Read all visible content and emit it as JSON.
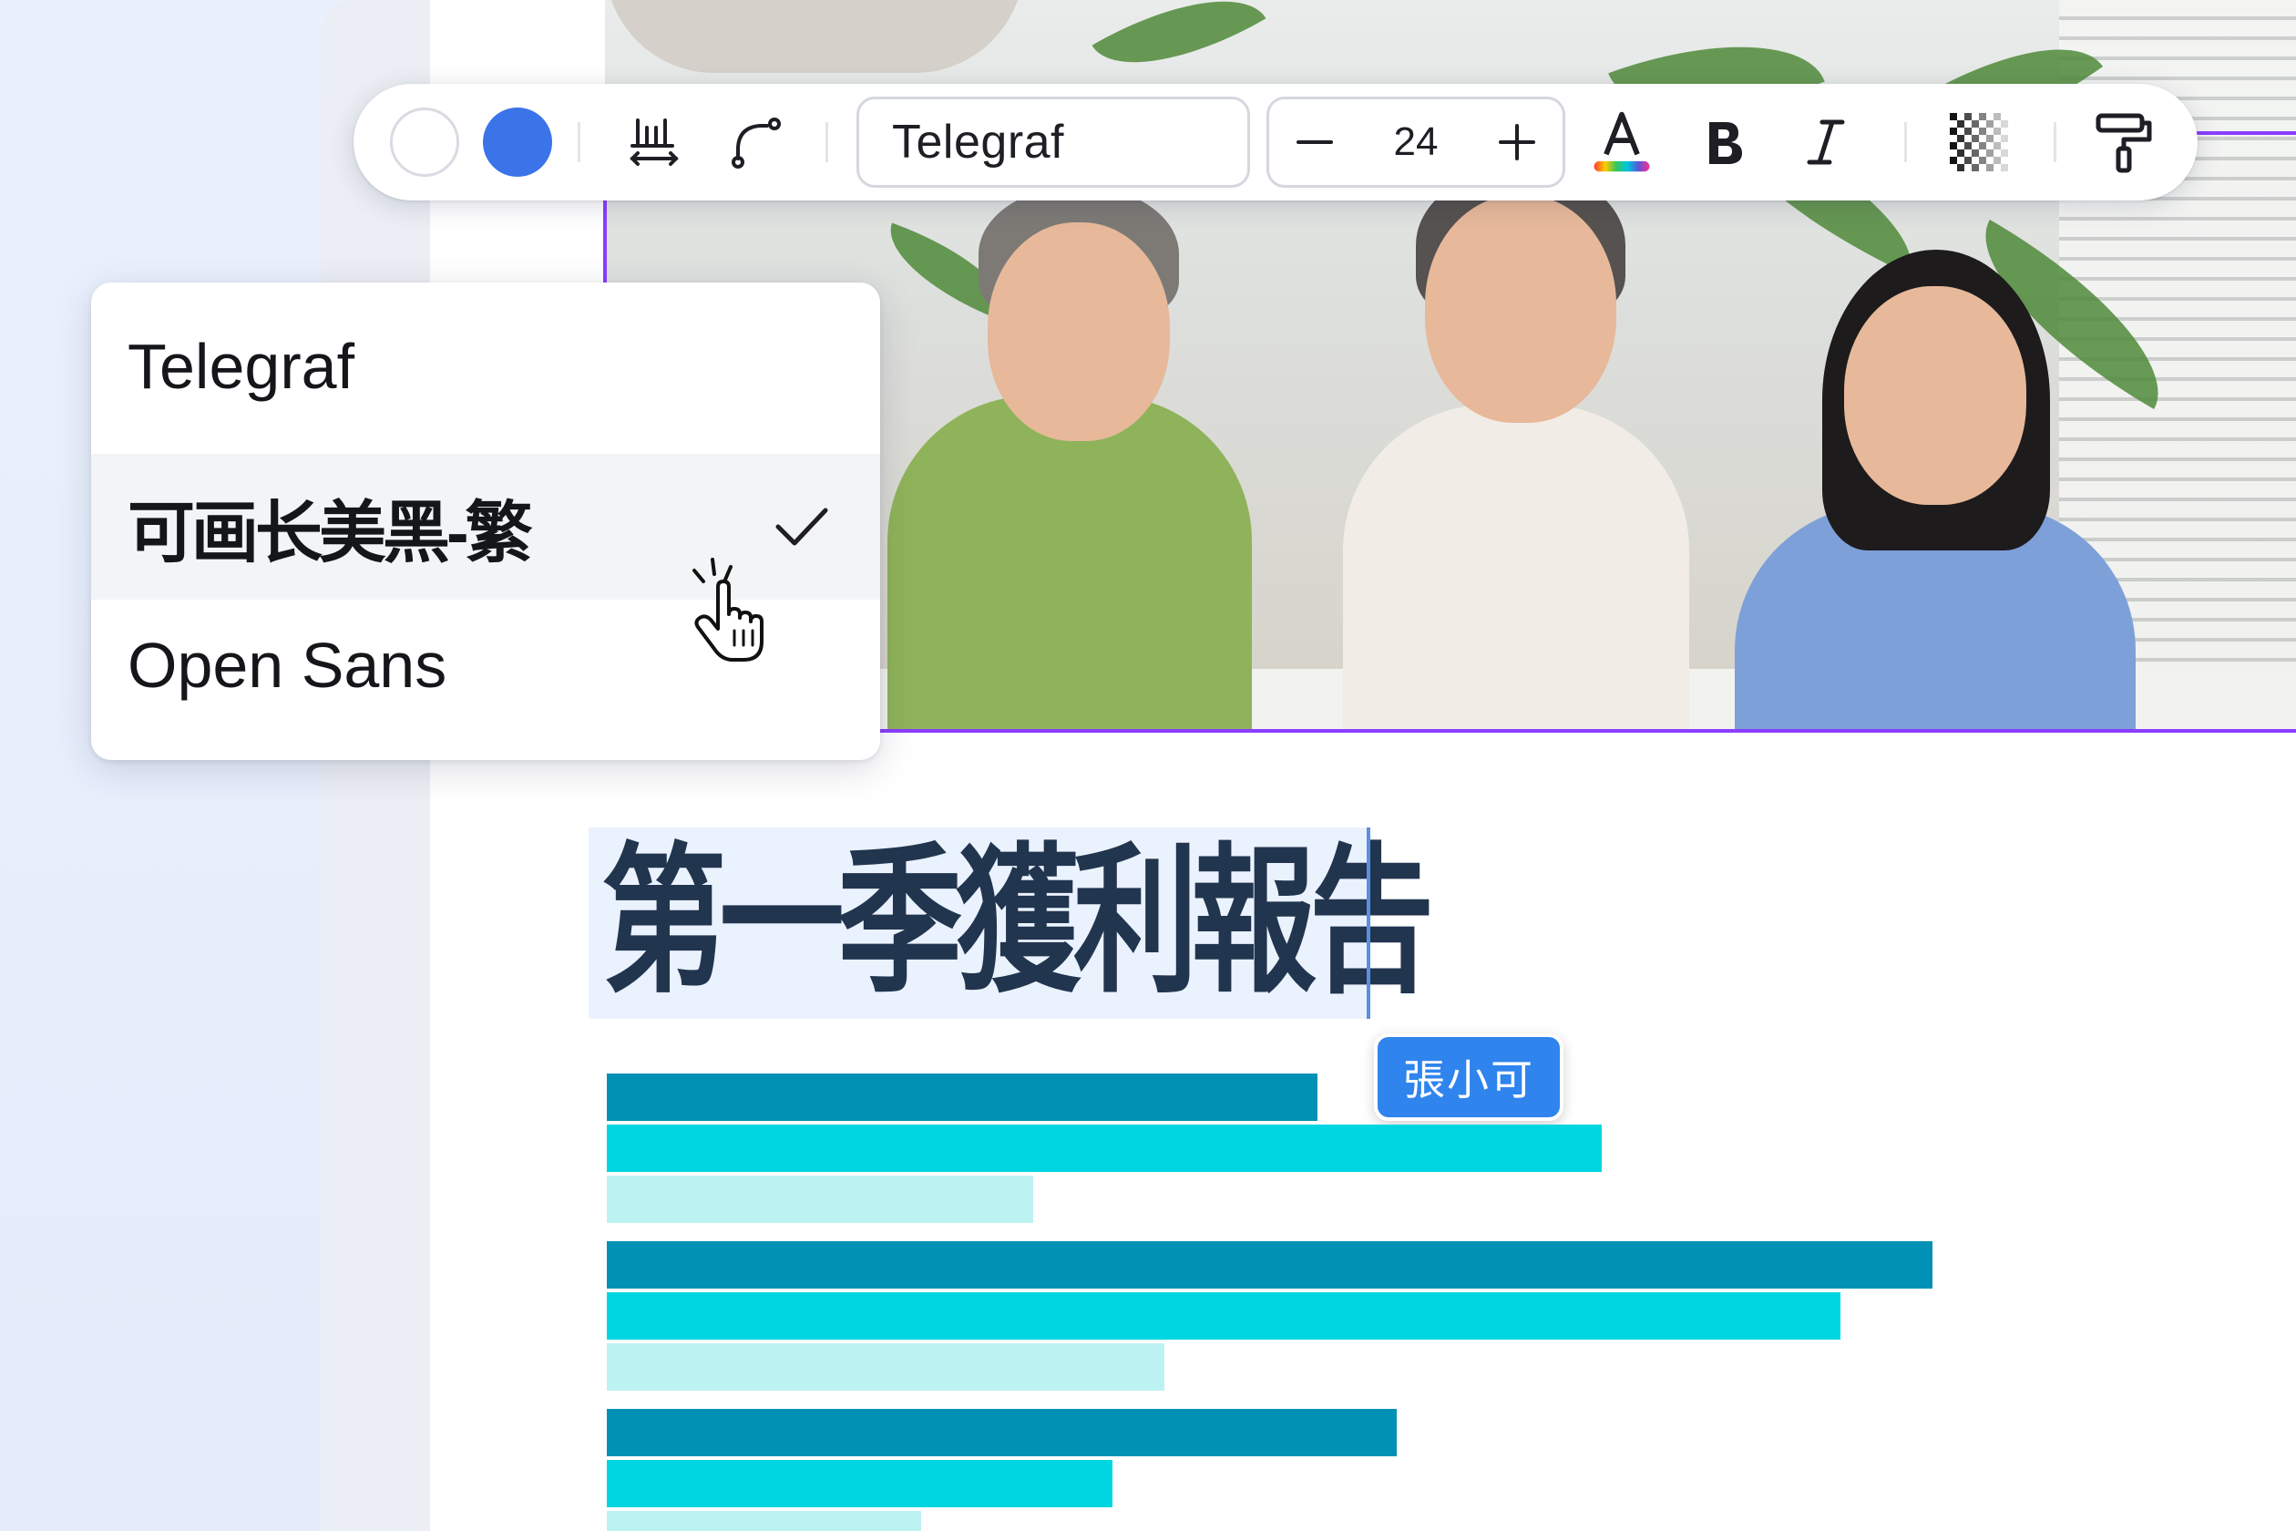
{
  "toolbar": {
    "colors": {
      "fill": "#ffffff",
      "text": "#3b73e8"
    },
    "font_name": "Telegraf",
    "font_size": "24",
    "icons": {
      "spacing": "text-spacing-icon",
      "curve": "curve-text-icon",
      "text_color": "text-color-icon",
      "bold": "bold-icon",
      "italic": "italic-icon",
      "transparency": "transparency-icon",
      "paint": "paint-roller-icon"
    }
  },
  "font_dropdown": {
    "items": [
      {
        "label": "Telegraf"
      },
      {
        "label": "可画长美黑-繁",
        "selected": true
      },
      {
        "label": "Open Sans"
      }
    ]
  },
  "document": {
    "title": "第一季獲利報告",
    "collaborator": "張小可"
  },
  "chart_data": {
    "type": "bar",
    "orientation": "horizontal",
    "groups": 3,
    "series": [
      {
        "values": [
          780,
          1455,
          867
        ],
        "color": "#0091b4"
      },
      {
        "values": [
          1092,
          1354,
          555
        ],
        "color": "#00d6e1"
      },
      {
        "values": [
          468,
          612,
          345
        ],
        "color": "#bdf2f3"
      }
    ]
  }
}
